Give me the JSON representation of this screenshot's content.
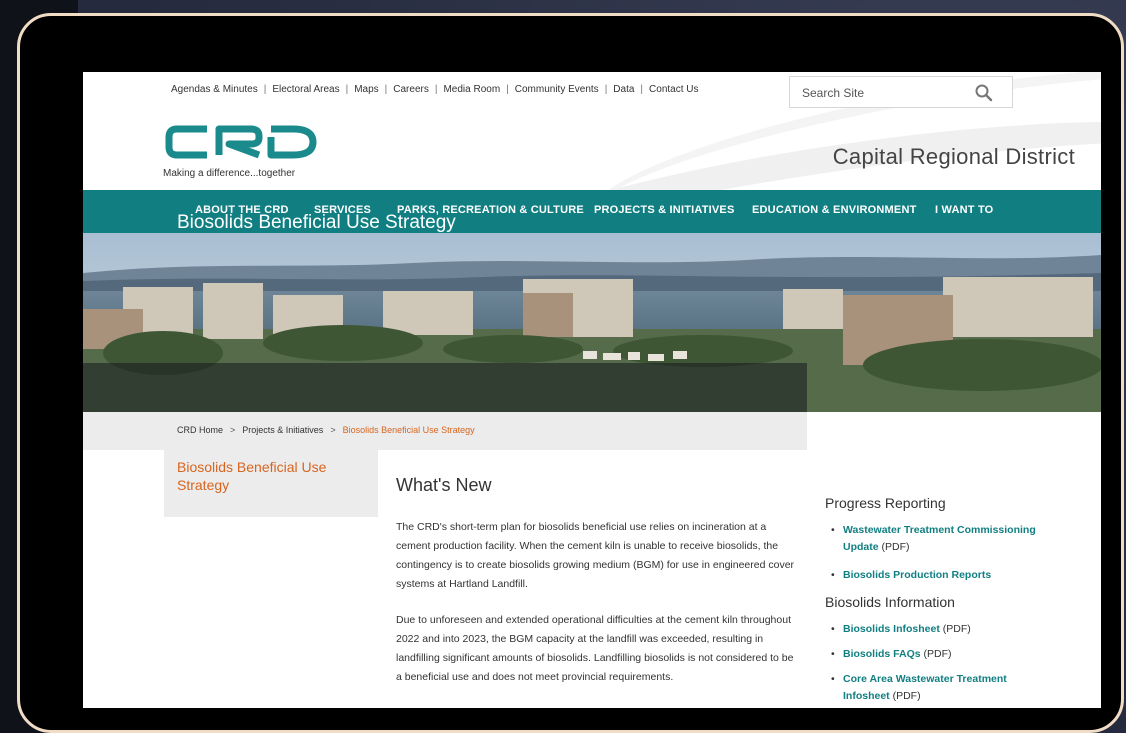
{
  "utility_nav": [
    "Agendas & Minutes",
    "Electoral Areas",
    "Maps",
    "Careers",
    "Media Room",
    "Community Events",
    "Data",
    "Contact Us"
  ],
  "search": {
    "placeholder": "Search Site"
  },
  "logo": {
    "tagline": "Making a difference...together"
  },
  "site_name": "Capital Regional District",
  "main_nav": [
    "ABOUT THE CRD",
    "SERVICES",
    "PARKS, RECREATION & CULTURE",
    "PROJECTS & INITIATIVES",
    "EDUCATION & ENVIRONMENT",
    "I WANT TO"
  ],
  "hero": {
    "title": "Biosolids Beneficial Use Strategy"
  },
  "breadcrumb": [
    "CRD Home",
    "Projects & Initiatives",
    "Biosolids Beneficial Use Strategy"
  ],
  "breadcrumb_sep": ">",
  "side_nav": {
    "title": "Biosolids Beneficial Use Strategy"
  },
  "main": {
    "heading": "What's New",
    "paragraphs": [
      "The CRD's short-term plan for biosolids beneficial use relies on incineration at a cement production facility. When the cement kiln is unable to receive biosolids, the contingency is to create biosolids growing medium (BGM) for use in engineered cover systems at Hartland Landfill.",
      "Due to unforeseen and extended operational difficulties at the cement kiln throughout 2022 and into 2023, the BGM capacity at the landfill was exceeded, resulting in landfilling significant amounts of biosolids. Landfilling biosolids is not considered to be a beneficial use and does not meet provincial requirements."
    ]
  },
  "sidebar": {
    "progress": {
      "heading": "Progress Reporting",
      "links": [
        {
          "label": "Wastewater Treatment Commissioning Update",
          "suffix": " (PDF)"
        },
        {
          "label": "Biosolids Production Reports",
          "suffix": ""
        }
      ]
    },
    "info": {
      "heading": "Biosolids Information",
      "links": [
        {
          "label": "Biosolids Infosheet",
          "suffix": " (PDF)"
        },
        {
          "label": "Biosolids FAQs",
          "suffix": " (PDF)"
        },
        {
          "label": "Core Area Wastewater Treatment Infosheet",
          "suffix": " (PDF)"
        }
      ]
    }
  },
  "colors": {
    "brand_teal": "#117f82",
    "accent_orange": "#d8651f",
    "device_frame": "#000000",
    "device_border": "#f1dcc5",
    "backdrop_navy": "#282d41"
  }
}
